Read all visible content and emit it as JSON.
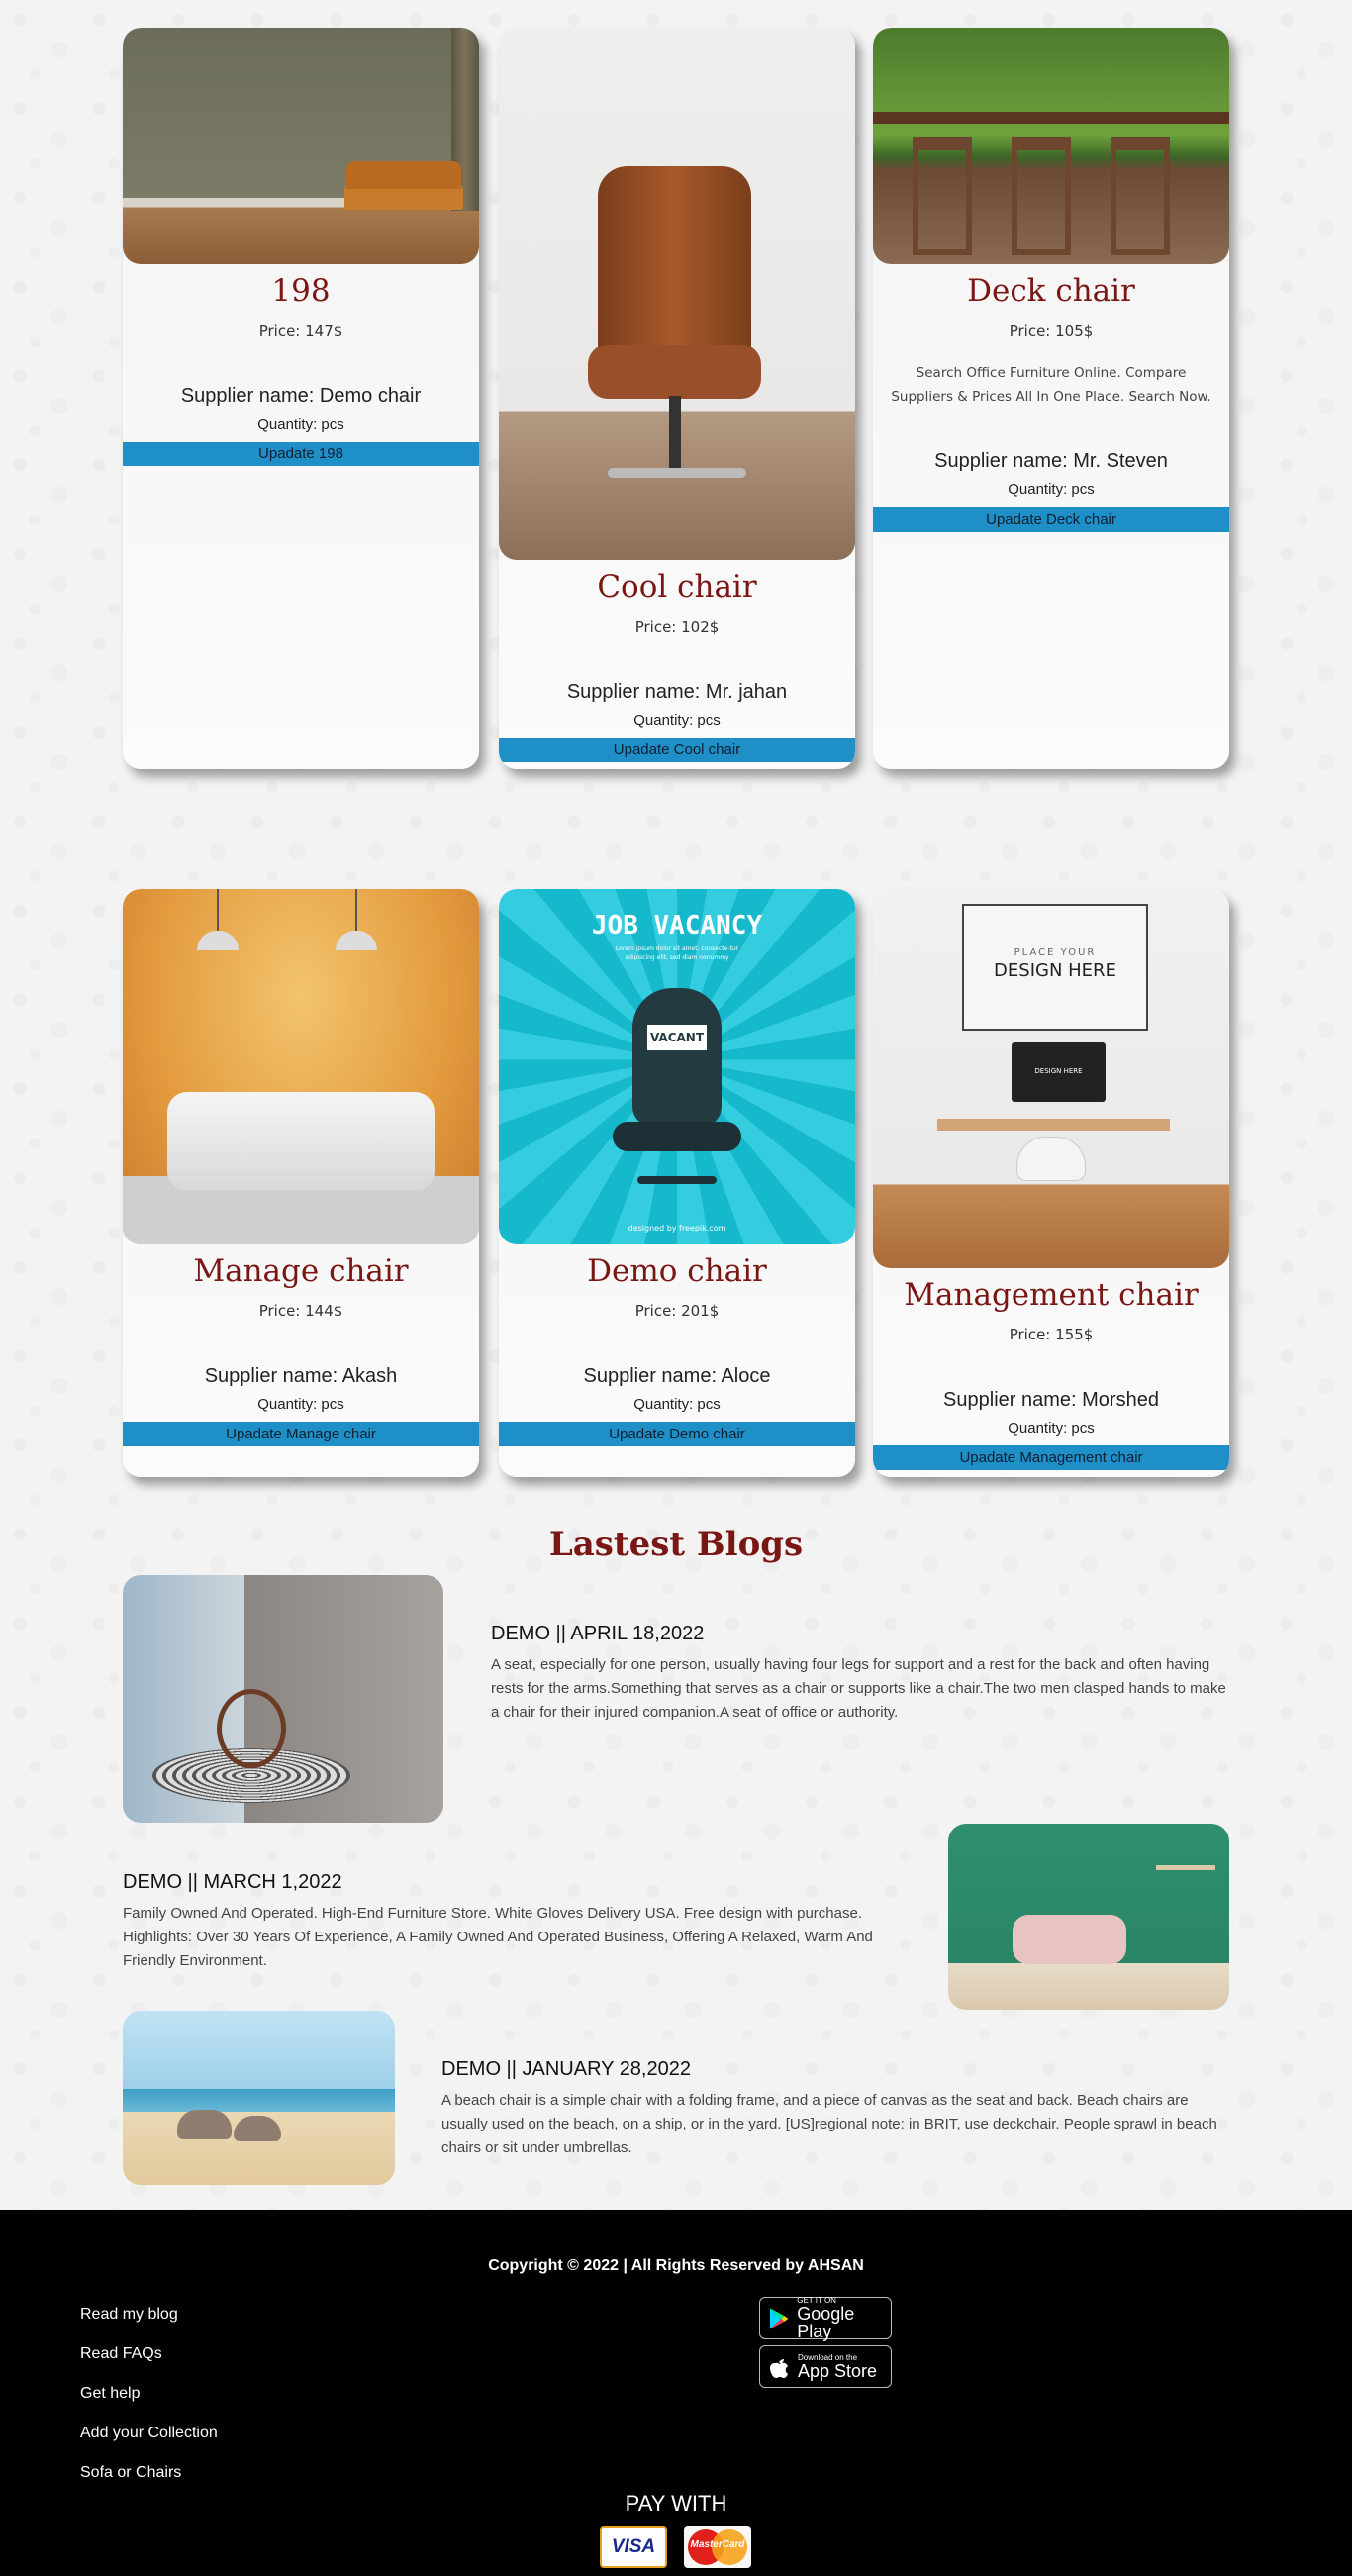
{
  "products": [
    {
      "name": "198",
      "price": "Price: 147$",
      "desc": "",
      "supplier": "Supplier name: Demo chair",
      "qty": "Quantity: pcs",
      "update": "Upadate 198"
    },
    {
      "name": "Cool chair",
      "price": "Price: 102$",
      "desc": "",
      "supplier": "Supplier name: Mr. jahan",
      "qty": "Quantity: pcs",
      "update": "Upadate Cool chair"
    },
    {
      "name": "Deck chair",
      "price": "Price: 105$",
      "desc": "Search Office Furniture Online. Compare Suppliers & Prices All In One Place. Search Now.",
      "supplier": "Supplier name: Mr. Steven",
      "qty": "Quantity: pcs",
      "update": "Upadate Deck chair"
    },
    {
      "name": "Manage chair",
      "price": "Price: 144$",
      "desc": "",
      "supplier": "Supplier name: Akash",
      "qty": "Quantity: pcs",
      "update": "Upadate Manage chair"
    },
    {
      "name": "Demo chair",
      "price": "Price: 201$",
      "desc": "",
      "supplier": "Supplier name: Aloce",
      "qty": "Quantity: pcs",
      "update": "Upadate Demo chair"
    },
    {
      "name": "Management chair",
      "price": "Price: 155$",
      "desc": "",
      "supplier": "Supplier name: Morshed",
      "qty": "Quantity: pcs",
      "update": "Upadate Management chair"
    }
  ],
  "poster": {
    "title": "JOB VACANCY",
    "lorem": "Lorem ipsum dolor sit amet, consecte-tur adipiscing elit, sed diam nonummy",
    "sign": "VACANT",
    "credit": "designed by freepik.com"
  },
  "frame": {
    "small": "PLACE YOUR",
    "big": "DESIGN HERE",
    "screen": "DESIGN HERE"
  },
  "blogs": {
    "title": "Lastest Blogs",
    "items": [
      {
        "head": "DEMO || APRIL 18,2022",
        "text": "A seat, especially for one person, usually having four legs for support and a rest for the back and often having rests for the arms.Something that serves as a chair or supports like a chair.The two men clasped hands to make a chair for their injured companion.A seat of office or authority."
      },
      {
        "head": "DEMO || MARCH 1,2022",
        "text": "Family Owned And Operated. High-End Furniture Store. White Gloves Delivery USA. Free design with purchase. Highlights: Over 30 Years Of Experience, A Family Owned And Operated Business, Offering A Relaxed, Warm And Friendly Environment."
      },
      {
        "head": "DEMO || JANUARY 28,2022",
        "text": "A beach chair is a simple chair with a folding frame, and a piece of canvas as the seat and back. Beach chairs are usually used on the beach, on a ship, or in the yard. [US]regional note: in BRIT, use deckchair. People sprawl in beach chairs or sit under umbrellas."
      }
    ]
  },
  "footer": {
    "copyright": "Copyright © 2022 | All Rights Reserved by AHSAN",
    "links": [
      "Read my blog",
      "Read FAQs",
      "Get help",
      "Add your Collection",
      "Sofa or Chairs"
    ],
    "google_small": "GET IT ON",
    "google_big": "Google Play",
    "apple_small": "Download on the",
    "apple_big": "App Store",
    "pay_with": "PAY WITH",
    "visa": "VISA",
    "mastercard": "MasterCard"
  }
}
